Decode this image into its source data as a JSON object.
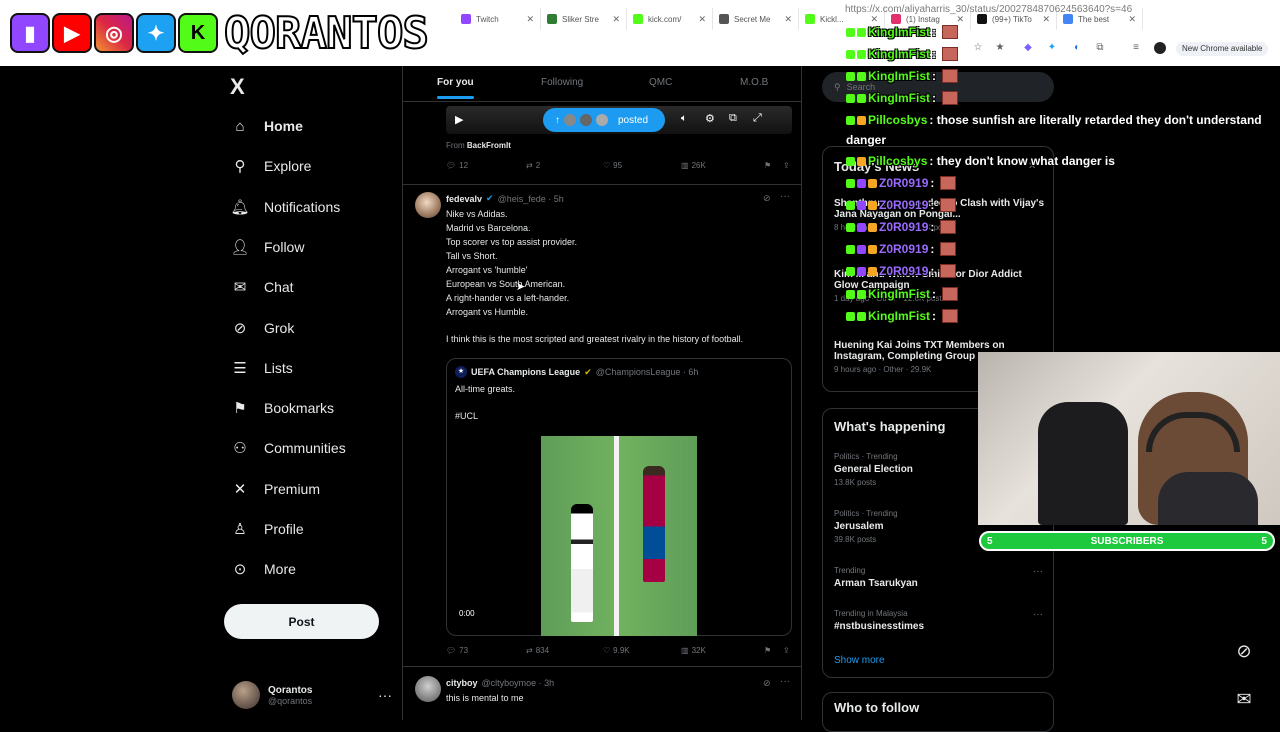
{
  "browser": {
    "tabs": [
      {
        "label": "Twitch",
        "color": "#9146ff"
      },
      {
        "label": "Sliker Stre",
        "color": "#2e7d32"
      },
      {
        "label": "kick.com/",
        "color": "#53fc18"
      },
      {
        "label": "Secret Me",
        "color": "#555555"
      },
      {
        "label": "Kickl...",
        "color": "#53fc18"
      },
      {
        "label": "(1) Instag",
        "color": "#e1306c"
      },
      {
        "label": "(99+) TikTo",
        "color": "#111111"
      },
      {
        "label": "The best",
        "color": "#4285f4"
      }
    ],
    "url": "https://x.com/aliyaharris_30/status/2002784870624563640?s=46",
    "new_chrome": "New Chrome available"
  },
  "overlay": {
    "brand": "QORANTOS",
    "subscribers_label": "SUBSCRIBERS",
    "subscribers_left": "5",
    "subscribers_right": "5"
  },
  "nav": {
    "logo": "X",
    "items": [
      {
        "label": "Home",
        "icon": "home-icon"
      },
      {
        "label": "Explore",
        "icon": "search-icon"
      },
      {
        "label": "Notifications",
        "icon": "bell-icon"
      },
      {
        "label": "Follow",
        "icon": "follow-icon"
      },
      {
        "label": "Chat",
        "icon": "mail-icon"
      },
      {
        "label": "Grok",
        "icon": "grok-icon"
      },
      {
        "label": "Lists",
        "icon": "lists-icon"
      },
      {
        "label": "Bookmarks",
        "icon": "bookmark-icon"
      },
      {
        "label": "Communities",
        "icon": "communities-icon"
      },
      {
        "label": "Premium",
        "icon": "x-icon"
      },
      {
        "label": "Profile",
        "icon": "profile-icon"
      },
      {
        "label": "More",
        "icon": "more-icon"
      }
    ],
    "post_label": "Post",
    "account_name": "Qorantos",
    "account_handle": "@qorantos"
  },
  "feed": {
    "tabs": [
      "For you",
      "Following",
      "QMC",
      "M.O.B"
    ],
    "posted_pill": "posted",
    "prev_tweet": {
      "from_label": "From",
      "from_name": "BackFromIt",
      "replies": "12",
      "retweets": "2",
      "likes": "95",
      "views": "26K"
    },
    "tweet": {
      "name": "fedevalv",
      "handle": "@heis_fede · 5h",
      "lines": [
        "Nike vs Adidas.",
        "Madrid vs Barcelona.",
        "Top scorer vs top assist provider.",
        "Tall vs Short.",
        "Arrogant vs 'humble'",
        "European vs South American.",
        "A right-hander vs a left-hander.",
        "Arrogant vs Humble."
      ],
      "body": "I think this is the most scripted and greatest rivalry in the history of football.",
      "quote_name": "UEFA Champions League",
      "quote_handle": "@ChampionsLeague · 6h",
      "quote_text": "All-time greats.",
      "quote_tag": "#UCL",
      "video_time": "0:00",
      "replies": "73",
      "retweets": "834",
      "likes": "9.9K",
      "views": "32K"
    },
    "next_tweet": {
      "name": "cityboy",
      "handle": "@cltyboymoe · 3h",
      "text": "this is mental to me"
    }
  },
  "right": {
    "search_placeholder": "Search",
    "news_title": "Today's News",
    "news": [
      {
        "title": "Shanthnu ... responded to Clash with Vijay's Jana Nayagan on Pongal...",
        "meta": "8 hours ago · Other · 49.8K posts"
      },
      {
        "title": "Kim ... and Willow Smith for Dior Addict Glow Campaign",
        "meta": "1 day ago · Other · 12.6K posts"
      },
      {
        "title": "Huening Kai Joins TXT Members on Instagram, Completing Group",
        "meta": "9 hours ago · Other · 29.9K"
      }
    ],
    "happening_title": "What's happening",
    "trends": [
      {
        "meta": "Politics · Trending",
        "title": "General Election",
        "count": "13.8K posts"
      },
      {
        "meta": "Politics · Trending",
        "title": "Jerusalem",
        "count": "39.8K posts"
      },
      {
        "meta": "Trending",
        "title": "Arman Tsarukyan",
        "count": ""
      },
      {
        "meta": "Trending in Malaysia",
        "title": "#nstbusinesstimes",
        "count": ""
      }
    ],
    "show_more": "Show more",
    "who_to_follow": "Who to follow"
  },
  "chat": [
    {
      "user": "KingImFist",
      "msg": ":"
    },
    {
      "user": "KingImFist",
      "msg": ":"
    },
    {
      "user": "KingImFist",
      "msg": ":"
    },
    {
      "user": "KingImFist",
      "msg": ":"
    },
    {
      "user": "Pillcosbys",
      "msg": ": those sunfish are literally retarded they don't understand"
    },
    {
      "user": "",
      "msg": "danger"
    },
    {
      "user": "Pillcosbys",
      "msg": ": they don't know what danger is"
    },
    {
      "user": "Z0R0919",
      "msg": ":"
    },
    {
      "user": "Z0R0919",
      "msg": ":"
    },
    {
      "user": "Z0R0919",
      "msg": ":"
    },
    {
      "user": "Z0R0919",
      "msg": ":"
    },
    {
      "user": "Z0R0919",
      "msg": ":"
    },
    {
      "user": "KingImFist",
      "msg": ":"
    },
    {
      "user": "KingImFist",
      "msg": ":"
    }
  ]
}
